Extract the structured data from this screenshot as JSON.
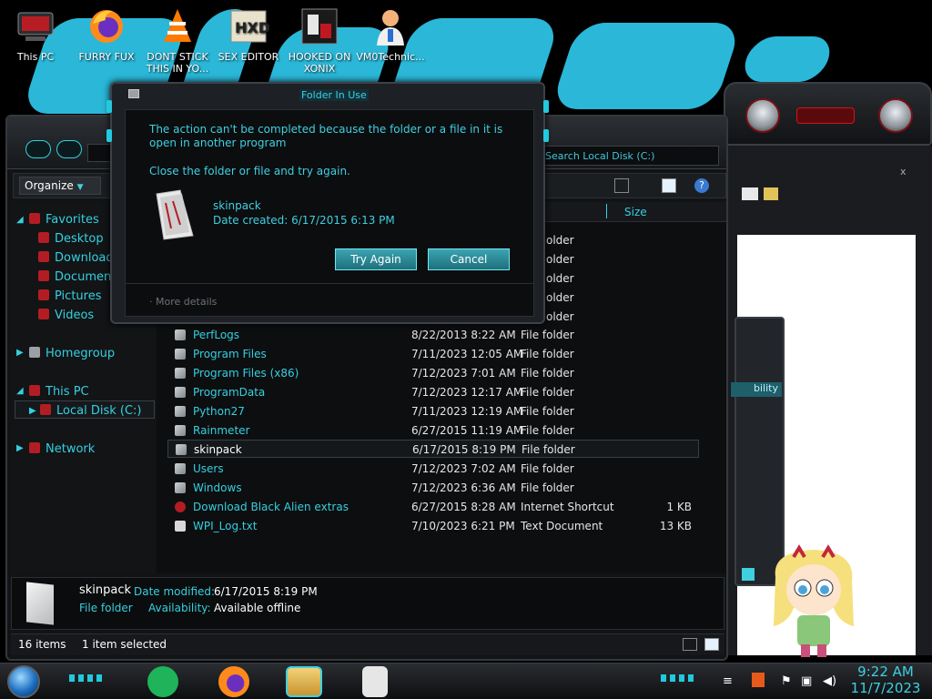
{
  "desktop_icons": [
    {
      "label": "This PC",
      "icon": "computer-icon"
    },
    {
      "label": "FURRY FUX",
      "icon": "firefox-icon"
    },
    {
      "label": "DONT STICK THIS IN YO...",
      "icon": "vlc-icon"
    },
    {
      "label": "SEX EDITOR",
      "icon": "hxd-icon"
    },
    {
      "label": "HOOKED ON XONIX",
      "icon": "game-icon"
    },
    {
      "label": "VM0Technic...",
      "icon": "doctor-icon"
    }
  ],
  "explorer": {
    "search_placeholder": "Search Local Disk (C:)",
    "organize": "Organize",
    "nav": {
      "favorites": "Favorites",
      "desktop": "Desktop",
      "downloads": "Download",
      "documents": "Documen",
      "pictures": "Pictures",
      "videos": "Videos",
      "homegroup": "Homegroup",
      "this_pc": "This PC",
      "local_disk": "Local Disk (C:)",
      "network": "Network"
    },
    "columns": {
      "size": "Size"
    },
    "partial_types": [
      "older",
      "older",
      "older",
      "older",
      "older"
    ],
    "files": [
      {
        "name": "PerfLogs",
        "date": "8/22/2013 8:22 AM",
        "type": "File folder",
        "size": ""
      },
      {
        "name": "Program Files",
        "date": "7/11/2023 12:05 AM",
        "type": "File folder",
        "size": ""
      },
      {
        "name": "Program Files (x86)",
        "date": "7/12/2023 7:01 AM",
        "type": "File folder",
        "size": ""
      },
      {
        "name": "ProgramData",
        "date": "7/12/2023 12:17 AM",
        "type": "File folder",
        "size": ""
      },
      {
        "name": "Python27",
        "date": "7/11/2023 12:19 AM",
        "type": "File folder",
        "size": ""
      },
      {
        "name": "Rainmeter",
        "date": "6/27/2015 11:19 AM",
        "type": "File folder",
        "size": ""
      },
      {
        "name": "skinpack",
        "date": "6/17/2015 8:19 PM",
        "type": "File folder",
        "size": ""
      },
      {
        "name": "Users",
        "date": "7/12/2023 7:02 AM",
        "type": "File folder",
        "size": ""
      },
      {
        "name": "Windows",
        "date": "7/12/2023 6:36 AM",
        "type": "File folder",
        "size": ""
      },
      {
        "name": "Download Black Alien extras",
        "date": "6/27/2015 8:28 AM",
        "type": "Internet Shortcut",
        "size": "1 KB"
      },
      {
        "name": "WPI_Log.txt",
        "date": "7/10/2023 6:21 PM",
        "type": "Text Document",
        "size": "13 KB"
      }
    ],
    "details": {
      "name": "skinpack",
      "kind": "File folder",
      "date_modified_label": "Date modified:",
      "date_modified": "6/17/2015 8:19 PM",
      "availability_label": "Availability:",
      "availability": "Available offline"
    },
    "status": {
      "items": "16 items",
      "selected": "1 item selected"
    }
  },
  "dialog": {
    "title": "Folder In Use",
    "message": "The action can't be completed because the folder or a file in it is open in another program",
    "hint": "Close the folder or file and try again.",
    "item_name": "skinpack",
    "item_date": "Date created: 6/17/2015 6:13 PM",
    "try_again": "Try Again",
    "cancel": "Cancel",
    "more_details": "More details"
  },
  "bg_window": {
    "partial_label": "bility"
  },
  "taskbar": {
    "time": "9:22 AM",
    "date": "11/7/2023"
  }
}
